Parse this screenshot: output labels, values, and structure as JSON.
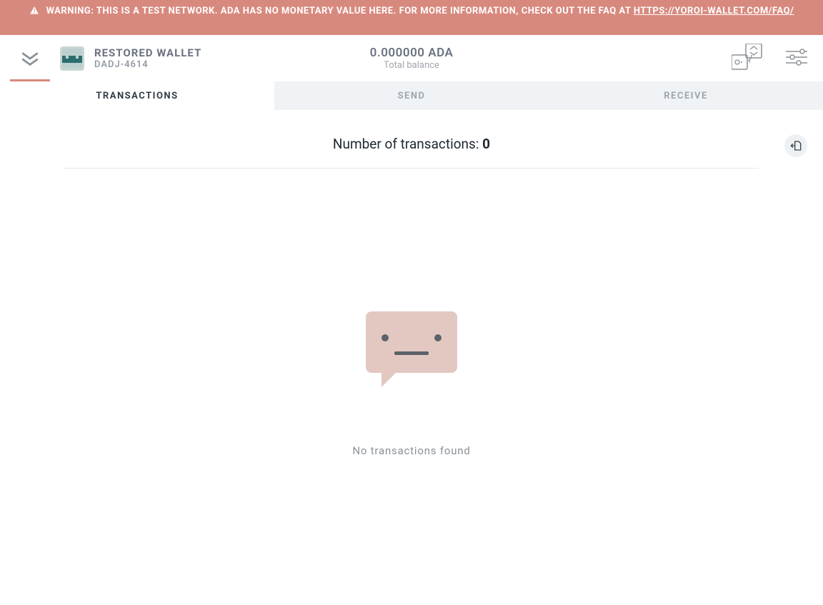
{
  "warning": {
    "prefix": "WARNING: THIS IS A TEST NETWORK. ADA HAS NO MONETARY VALUE HERE. FOR MORE INFORMATION, CHECK OUT THE FAQ AT ",
    "link_text": "HTTPS://YOROI-WALLET.COM/FAQ/"
  },
  "header": {
    "wallet_name": "RESTORED WALLET",
    "wallet_hash": "DADJ-4614",
    "balance_amount": "0.000000 ADA",
    "balance_label": "Total balance"
  },
  "tabs": {
    "transactions": "TRANSACTIONS",
    "send": "SEND",
    "receive": "RECEIVE"
  },
  "content": {
    "tx_count_label": "Number of transactions: ",
    "tx_count_value": "0",
    "empty_message": "No transactions found"
  }
}
